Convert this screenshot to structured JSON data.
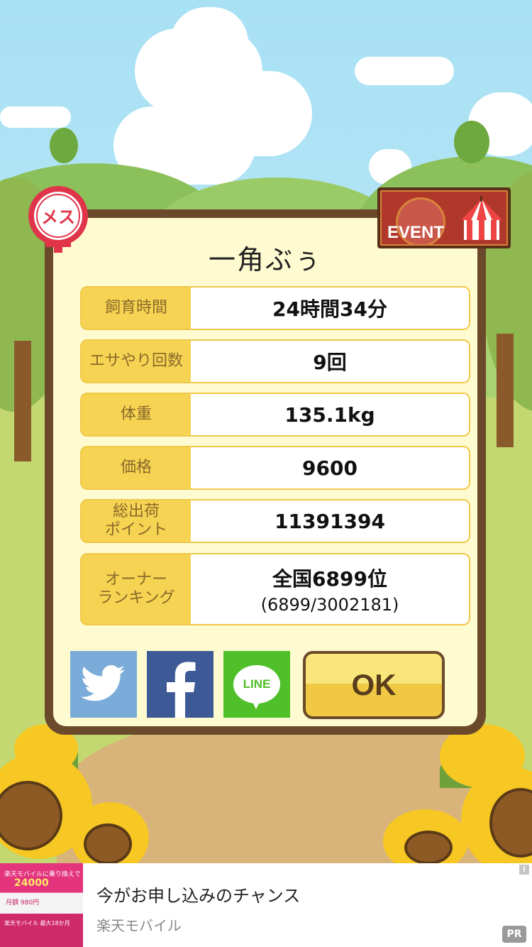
{
  "dialog": {
    "title": "一角ぶぅ",
    "stats": [
      {
        "label": "飼育時間",
        "value": "24時間34分"
      },
      {
        "label": "エサやり回数",
        "value": "9回"
      },
      {
        "label": "体重",
        "value": "135.1kg"
      },
      {
        "label": "価格",
        "value": "9600"
      },
      {
        "label": "総出荷\nポイント",
        "value": "11391394"
      },
      {
        "label": "オーナー\nランキング",
        "value": "全国6899位",
        "sub": "(6899/3002181)"
      }
    ],
    "ok_label": "OK"
  },
  "badges": {
    "gender": "メス",
    "event": "EVENT"
  },
  "share": {
    "twitter_icon": "twitter-bird-icon",
    "facebook_icon": "facebook-f-icon",
    "line_label": "LINE"
  },
  "ad": {
    "title": "今がお申し込みのチャンス",
    "advertiser": "楽天モバイル",
    "pr_label": "PR",
    "info_label": "i",
    "thumb_text": [
      "楽天モバイルに乗り換えで",
      "24000",
      "月額 980円",
      "楽天モバイル 最大18か月"
    ]
  },
  "colors": {
    "dialog_border": "#6b4a2c",
    "dialog_bg": "#fffbd1",
    "stat_label_bg": "#f6d352",
    "twitter": "#7aabd9",
    "facebook": "#3d5a96",
    "line": "#4fbf2a",
    "ok_button": "#f0c843"
  }
}
